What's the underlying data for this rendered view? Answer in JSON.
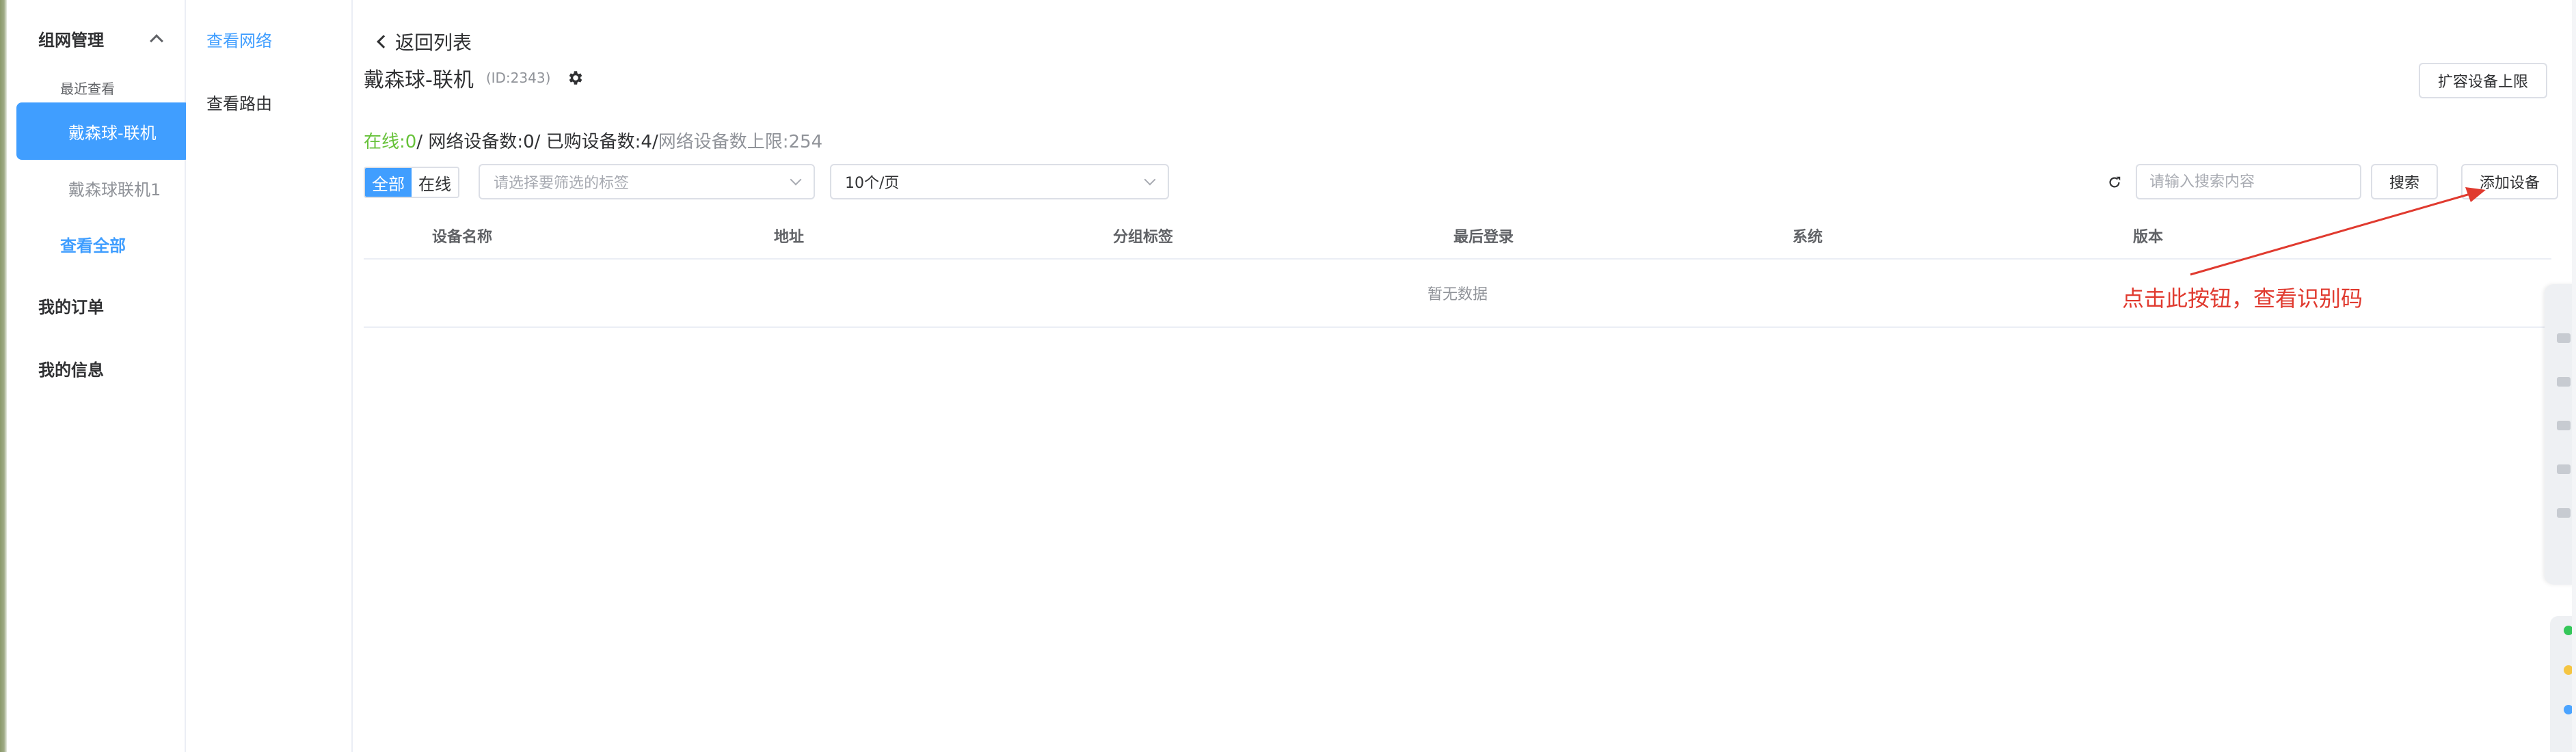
{
  "sidebar": {
    "group_title": "组网管理",
    "recent_label": "最近查看",
    "active_item": "戴森球-联机",
    "second_item": "戴森球联机1",
    "view_all": "查看全部",
    "orders": "我的订单",
    "info": "我的信息"
  },
  "subnav": {
    "network": "查看网络",
    "route": "查看路由"
  },
  "header": {
    "back": "返回列表",
    "title": "戴森球-联机",
    "id": "(ID:2343)",
    "expand_button": "扩容设备上限"
  },
  "stats": {
    "online": "在线:0",
    "network_devices": "/ 网络设备数:0",
    "purchased": "/ 已购设备数:4/",
    "limit": " 网络设备数上限:254"
  },
  "filters": {
    "seg_all": "全部",
    "seg_online": "在线",
    "tag_placeholder": "请选择要筛选的标签",
    "page_size": "10个/页",
    "search_placeholder": "请输入搜索内容",
    "search_button": "搜索",
    "add_button": "添加设备"
  },
  "table": {
    "columns": [
      "设备名称",
      "地址",
      "分组标签",
      "最后登录",
      "系统",
      "版本"
    ],
    "empty_text": "暂无数据"
  },
  "annotation": {
    "text": "点击此按钮，查看识别码",
    "color": "#e03a2f"
  },
  "colors": {
    "primary": "#409eff",
    "online_green": "#67c23a"
  }
}
